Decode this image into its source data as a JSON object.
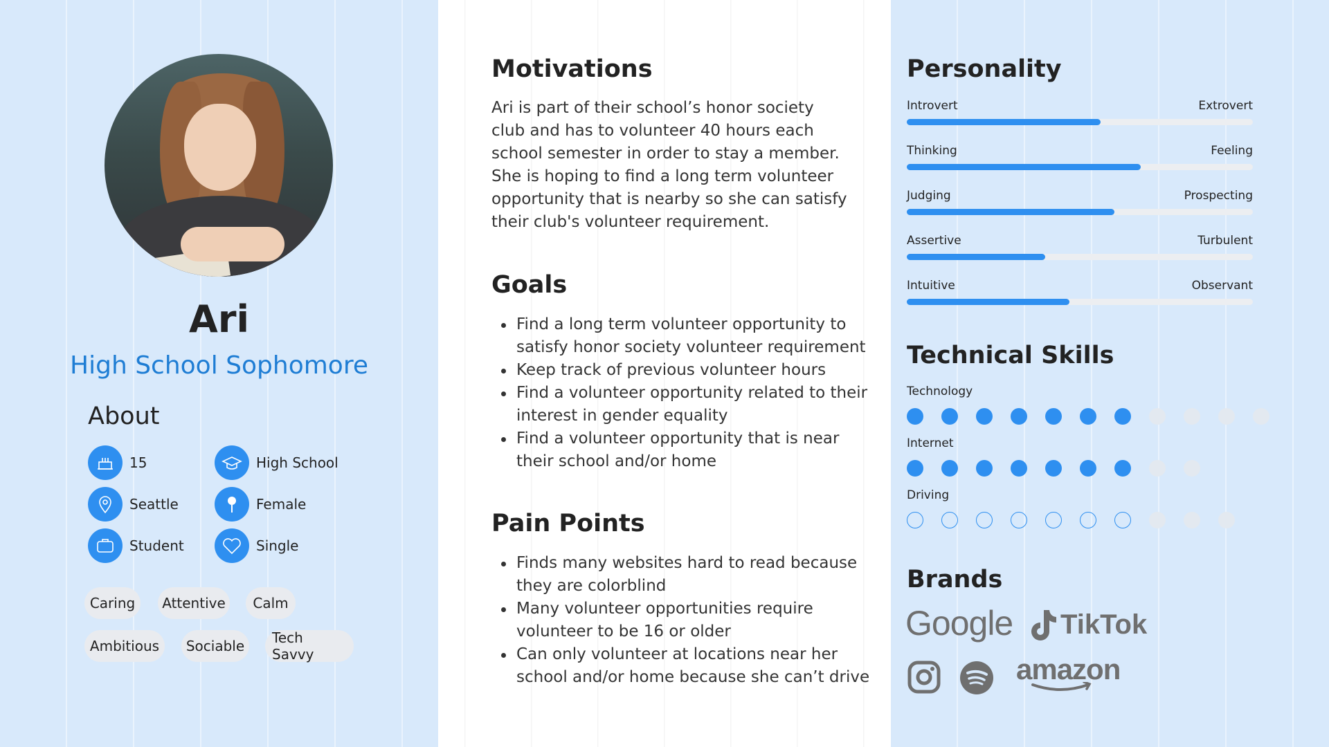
{
  "profile": {
    "name": "Ari",
    "role": "High School Sophomore"
  },
  "about": {
    "title": "About",
    "items": [
      {
        "icon": "cake-icon",
        "text": "15"
      },
      {
        "icon": "graduation-cap-icon",
        "text": "High School"
      },
      {
        "icon": "location-pin-icon",
        "text": "Seattle"
      },
      {
        "icon": "gender-pin-icon",
        "text": "Female"
      },
      {
        "icon": "briefcase-icon",
        "text": "Student"
      },
      {
        "icon": "heart-icon",
        "text": "Single"
      }
    ],
    "tags": [
      "Caring",
      "Attentive",
      "Calm",
      "Ambitious",
      "Sociable",
      "Tech Savvy"
    ]
  },
  "motivations": {
    "title": "Motivations",
    "text": "Ari is part of their school’s honor society club and has to volunteer 40 hours each school semester in order to stay a member. She is hoping to find a long term volunteer opportunity that is nearby so she can satisfy their club's volunteer requirement."
  },
  "goals": {
    "title": "Goals",
    "items": [
      "Find a long term volunteer opportunity to satisfy honor society volunteer requirement",
      "Keep track of previous volunteer hours",
      "Find a volunteer opportunity related to their interest in gender equality",
      "Find a volunteer opportunity that is near their school and/or home"
    ]
  },
  "pain_points": {
    "title": "Pain Points",
    "items": [
      "Finds many websites hard to read because they are colorblind",
      "Many volunteer opportunities require volunteer to be 16 or older",
      "Can only volunteer at locations near her school and/or home because she can’t drive"
    ]
  },
  "personality": {
    "title": "Personality",
    "traits": [
      {
        "left": "Introvert",
        "right": "Extrovert",
        "value": 0.56
      },
      {
        "left": "Thinking",
        "right": "Feeling",
        "value": 0.675
      },
      {
        "left": "Judging",
        "right": "Prospecting",
        "value": 0.6
      },
      {
        "left": "Assertive",
        "right": "Turbulent",
        "value": 0.4
      },
      {
        "left": "Intuitive",
        "right": "Observant",
        "value": 0.47
      }
    ]
  },
  "technical_skills": {
    "title": "Technical Skills",
    "skills": [
      {
        "label": "Technology",
        "level": 7,
        "total": 11,
        "style": "filled"
      },
      {
        "label": "Internet",
        "level": 7,
        "total": 9,
        "style": "filled"
      },
      {
        "label": "Driving",
        "level": 7,
        "total": 10,
        "style": "outline"
      }
    ]
  },
  "brands": {
    "title": "Brands",
    "items": [
      "Google",
      "TikTok",
      "Instagram",
      "Spotify",
      "amazon"
    ]
  },
  "colors": {
    "accent": "#2e8ff0",
    "role_text": "#1e7dd4",
    "panel_bg": "#d8e9fb"
  }
}
